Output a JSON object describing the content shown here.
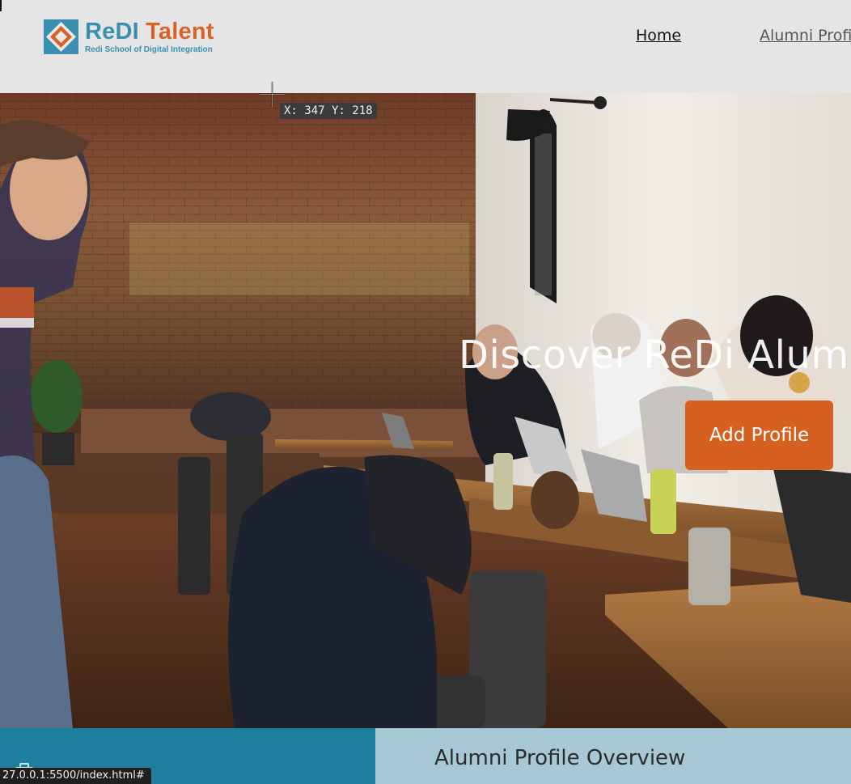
{
  "header": {
    "logo_title_a": "ReDI",
    "logo_title_b": "Talent",
    "logo_subtitle": "Redi School of Digital Integration",
    "nav": {
      "home": "Home",
      "alumni": "Alumni Profiles"
    }
  },
  "hero": {
    "title": "Discover ReDi Alumni",
    "add_profile_label": "Add Profile",
    "image_description_icon": "cafe-photo"
  },
  "overlay": {
    "coord_readout": "X: 347 Y: 218"
  },
  "section": {
    "overview_title": "Alumni Profile Overview"
  },
  "status_bar": {
    "url": "27.0.0.1:5500/index.html#"
  },
  "colors": {
    "accent_orange": "#d6601f",
    "brand_blue": "#3a8fb0",
    "section_teal": "#1e7e9e",
    "section_light": "#a6c9d5"
  }
}
